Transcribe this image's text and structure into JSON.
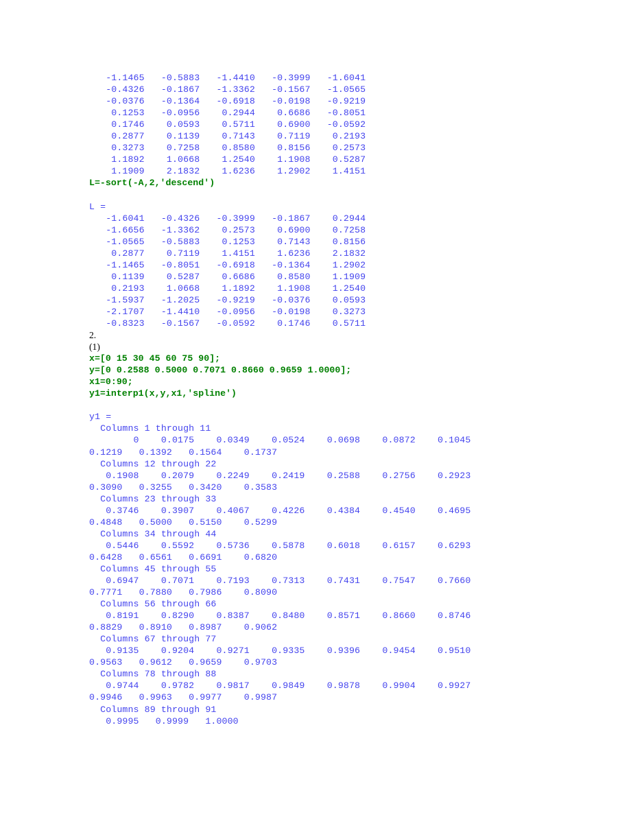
{
  "document": {
    "kind": "matlab-session-transcript",
    "colors": {
      "output_text": "#4444ee",
      "code_text": "#008000",
      "section_text": "#000000",
      "background": "#ffffff"
    },
    "blocks": [
      {
        "id": "matrix-A-tail",
        "kind": "output",
        "lines": [
          "   -1.1465   -0.5883   -1.4410   -0.3999   -1.6041",
          "   -0.4326   -0.1867   -1.3362   -0.1567   -1.0565",
          "   -0.0376   -0.1364   -0.6918   -0.0198   -0.9219",
          "    0.1253   -0.0956    0.2944    0.6686   -0.8051",
          "    0.1746    0.0593    0.5711    0.6900   -0.0592",
          "    0.2877    0.1139    0.7143    0.7119    0.2193",
          "    0.3273    0.7258    0.8580    0.8156    0.2573",
          "    1.1892    1.0668    1.2540    1.1908    0.5287",
          "    1.1909    2.1832    1.6236    1.2902    1.4151"
        ]
      },
      {
        "id": "cmd-sort-descend",
        "kind": "code",
        "lines": [
          "L=-sort(-A,2,'descend')"
        ]
      },
      {
        "id": "spacer-1",
        "kind": "blank",
        "lines": [
          ""
        ]
      },
      {
        "id": "result-L",
        "kind": "output",
        "lines": [
          "L =",
          "   -1.6041   -0.4326   -0.3999   -0.1867    0.2944",
          "   -1.6656   -1.3362    0.2573    0.6900    0.7258",
          "   -1.0565   -0.5883    0.1253    0.7143    0.8156",
          "    0.2877    0.7119    1.4151    1.6236    2.1832",
          "   -1.1465   -0.8051   -0.6918   -0.1364    1.2902",
          "    0.1139    0.5287    0.6686    0.8580    1.1909",
          "    0.2193    1.0668    1.1892    1.1908    1.2540",
          "   -1.5937   -1.2025   -0.9219   -0.0376    0.0593",
          "   -2.1707   -1.4410   -0.0956   -0.0198    0.3273",
          "   -0.8323   -0.1567   -0.0592    0.1746    0.5711"
        ]
      },
      {
        "id": "section-2",
        "kind": "section",
        "lines": [
          "2.",
          "(1)"
        ]
      },
      {
        "id": "cmd-interp-setup",
        "kind": "code",
        "lines": [
          "x=[0 15 30 45 60 75 90];",
          "y=[0 0.2588 0.5000 0.7071 0.8660 0.9659 1.0000];",
          "x1=0:90;",
          "y1=interp1(x,y,x1,'spline')"
        ]
      },
      {
        "id": "spacer-2",
        "kind": "blank",
        "lines": [
          ""
        ]
      },
      {
        "id": "result-y1",
        "kind": "output",
        "lines": [
          "y1 =",
          "  Columns 1 through 11",
          "        0    0.0175    0.0349    0.0524    0.0698    0.0872    0.1045",
          "0.1219   0.1392   0.1564    0.1737",
          "  Columns 12 through 22",
          "   0.1908    0.2079    0.2249    0.2419    0.2588    0.2756    0.2923",
          "0.3090   0.3255   0.3420    0.3583",
          "  Columns 23 through 33",
          "   0.3746    0.3907    0.4067    0.4226    0.4384    0.4540    0.4695",
          "0.4848   0.5000   0.5150    0.5299",
          "  Columns 34 through 44",
          "   0.5446    0.5592    0.5736    0.5878    0.6018    0.6157    0.6293",
          "0.6428   0.6561   0.6691    0.6820",
          "  Columns 45 through 55",
          "   0.6947    0.7071    0.7193    0.7313    0.7431    0.7547    0.7660",
          "0.7771   0.7880   0.7986    0.8090",
          "  Columns 56 through 66",
          "   0.8191    0.8290    0.8387    0.8480    0.8571    0.8660    0.8746",
          "0.8829   0.8910   0.8987    0.9062",
          "  Columns 67 through 77",
          "   0.9135    0.9204    0.9271    0.9335    0.9396    0.9454    0.9510",
          "0.9563   0.9612   0.9659    0.9703",
          "  Columns 78 through 88",
          "   0.9744    0.9782    0.9817    0.9849    0.9878    0.9904    0.9927",
          "0.9946   0.9963   0.9977    0.9987",
          "  Columns 89 through 91",
          "   0.9995   0.9999   1.0000"
        ]
      }
    ]
  }
}
